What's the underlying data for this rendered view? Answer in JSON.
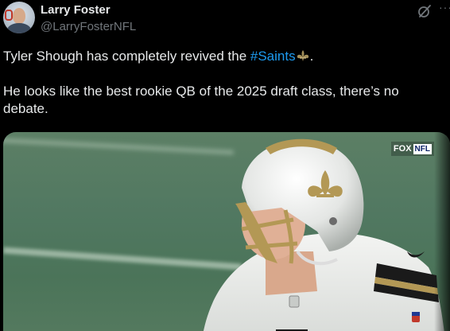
{
  "tweet": {
    "author": {
      "display_name": "Larry Foster",
      "handle": "@LarryFosterNFL"
    },
    "text_line1_before": "Tyler Shough has completely revived the ",
    "hashtag": "#Saints",
    "text_line1_after": ".",
    "text_line2": "He looks like the best rookie QB of the 2025 draft class, there’s no debate.",
    "emoji": "fleur-de-lis",
    "menu_icon": "more-icon",
    "grok_icon": "grok-icon"
  },
  "media": {
    "network_badge": {
      "fox": "FOX",
      "nfl": "NFL"
    }
  },
  "colors": {
    "accent": "#1d9bf0",
    "background": "#000000",
    "text": "#e7e9ea",
    "secondary": "#71767b"
  }
}
